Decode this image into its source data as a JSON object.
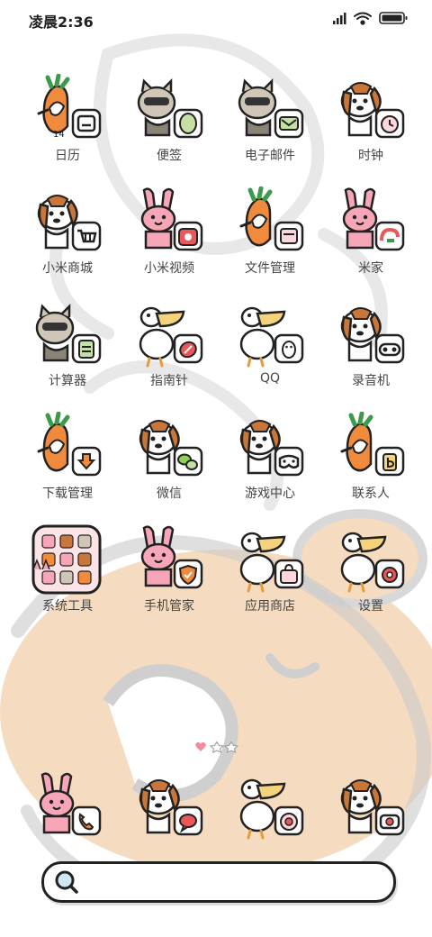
{
  "status_bar": {
    "time": "凌晨2:36"
  },
  "apps": [
    {
      "label": "日历",
      "character": "carrot",
      "glyph": "calendar-icon",
      "badge_text": "14"
    },
    {
      "label": "便签",
      "character": "raccoon",
      "glyph": "note-icon"
    },
    {
      "label": "电子邮件",
      "character": "raccoon",
      "glyph": "mail-icon"
    },
    {
      "label": "时钟",
      "character": "beagle",
      "glyph": "clock-icon"
    },
    {
      "label": "小米商城",
      "character": "beagle",
      "glyph": "shopping-cart-icon"
    },
    {
      "label": "小米视频",
      "character": "bunny",
      "glyph": "video-icon"
    },
    {
      "label": "文件管理",
      "character": "carrot",
      "glyph": "folder-icon"
    },
    {
      "label": "米家",
      "character": "bunny",
      "glyph": "home-icon"
    },
    {
      "label": "计算器",
      "character": "raccoon",
      "glyph": "calculator-icon"
    },
    {
      "label": "指南针",
      "character": "pelican",
      "glyph": "compass-icon"
    },
    {
      "label": "QQ",
      "character": "pelican",
      "glyph": "penguin-icon"
    },
    {
      "label": "录音机",
      "character": "beagle",
      "glyph": "recorder-icon"
    },
    {
      "label": "下载管理",
      "character": "carrot",
      "glyph": "download-icon"
    },
    {
      "label": "微信",
      "character": "beagle",
      "glyph": "chat-icon"
    },
    {
      "label": "游戏中心",
      "character": "beagle",
      "glyph": "gamepad-icon"
    },
    {
      "label": "联系人",
      "character": "carrot",
      "glyph": "contacts-icon"
    },
    {
      "label": "系统工具",
      "character": "folder",
      "glyph": "folder-grid-icon"
    },
    {
      "label": "手机管家",
      "character": "bunny",
      "glyph": "shield-icon"
    },
    {
      "label": "应用商店",
      "character": "pelican",
      "glyph": "shopping-bag-icon"
    },
    {
      "label": "设置",
      "character": "pelican",
      "glyph": "gear-icon"
    }
  ],
  "page_indicator": {
    "count": 3,
    "active": 0
  },
  "dock": [
    {
      "character": "bunny",
      "glyph": "phone-icon"
    },
    {
      "character": "beagle",
      "glyph": "message-icon"
    },
    {
      "character": "pelican",
      "glyph": "browser-icon"
    },
    {
      "character": "beagle",
      "glyph": "camera-icon"
    }
  ],
  "search": {
    "icon": "search-icon"
  },
  "colors": {
    "accent_red": "#e8585a",
    "carrot_orange": "#f08a3c",
    "wallpaper_tan": "#f5dcc0",
    "bunny_pink": "#f6a6b6"
  }
}
